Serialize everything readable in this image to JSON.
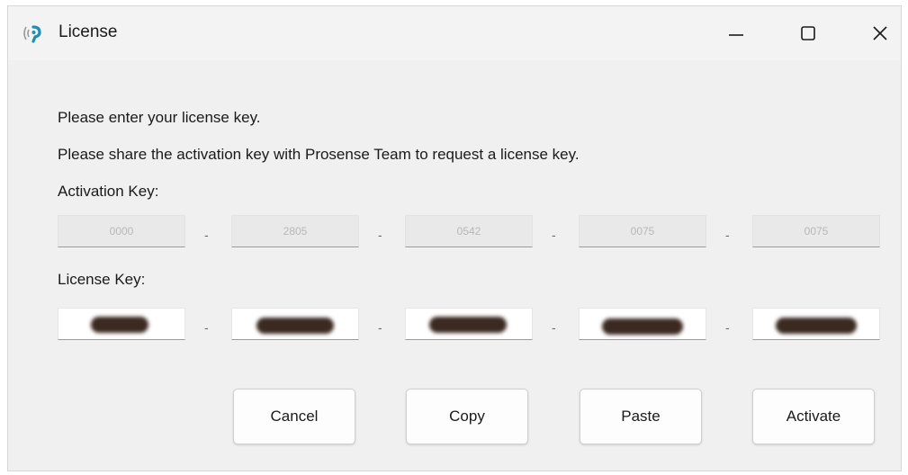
{
  "window": {
    "title": "License",
    "icon": "signal-broadcast-icon",
    "accent_color": "#1f8fb0"
  },
  "controls": {
    "minimize": "minimize-icon",
    "maximize": "maximize-icon",
    "close": "close-icon"
  },
  "body": {
    "prompt": "Please enter your license key.",
    "instruction": "Please share the activation key with Prosense Team to request a  license key.",
    "activation_label": "Activation Key:",
    "activation_values": [
      "0000",
      "2805",
      "0542",
      "0075",
      "0075"
    ],
    "license_label": "License Key:",
    "separator": "-"
  },
  "buttons": {
    "cancel": "Cancel",
    "copy": "Copy",
    "paste": "Paste",
    "activate": "Activate"
  }
}
